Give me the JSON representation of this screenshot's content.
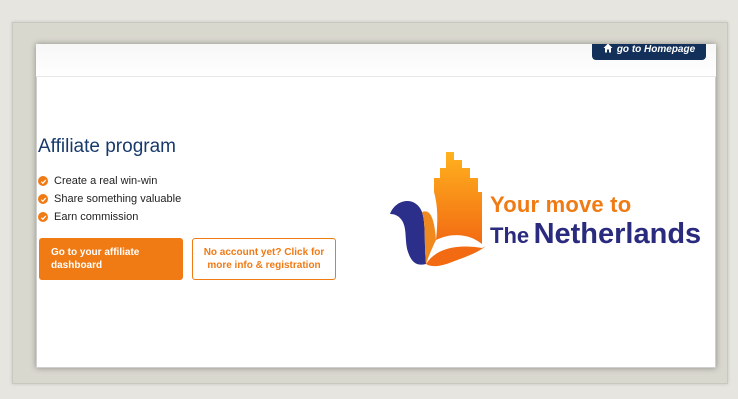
{
  "header": {
    "home_label": "go to Homepage"
  },
  "main": {
    "title": "Affiliate program",
    "features": [
      "Create a real win-win",
      "Share something valuable",
      "Earn commission"
    ],
    "primary_button": "Go to your affiliate dashboard",
    "secondary_button": "No account yet? Click for more info & registration"
  },
  "logo": {
    "line1": "Your move to",
    "line2_prefix": "The",
    "line2_main": "Netherlands"
  },
  "colors": {
    "accent": "#f07a14",
    "navy": "#12305a",
    "brand_purple": "#2a2a7e",
    "title": "#183a6b"
  },
  "icons": [
    "home-icon",
    "check-icon",
    "house-logo-icon"
  ]
}
